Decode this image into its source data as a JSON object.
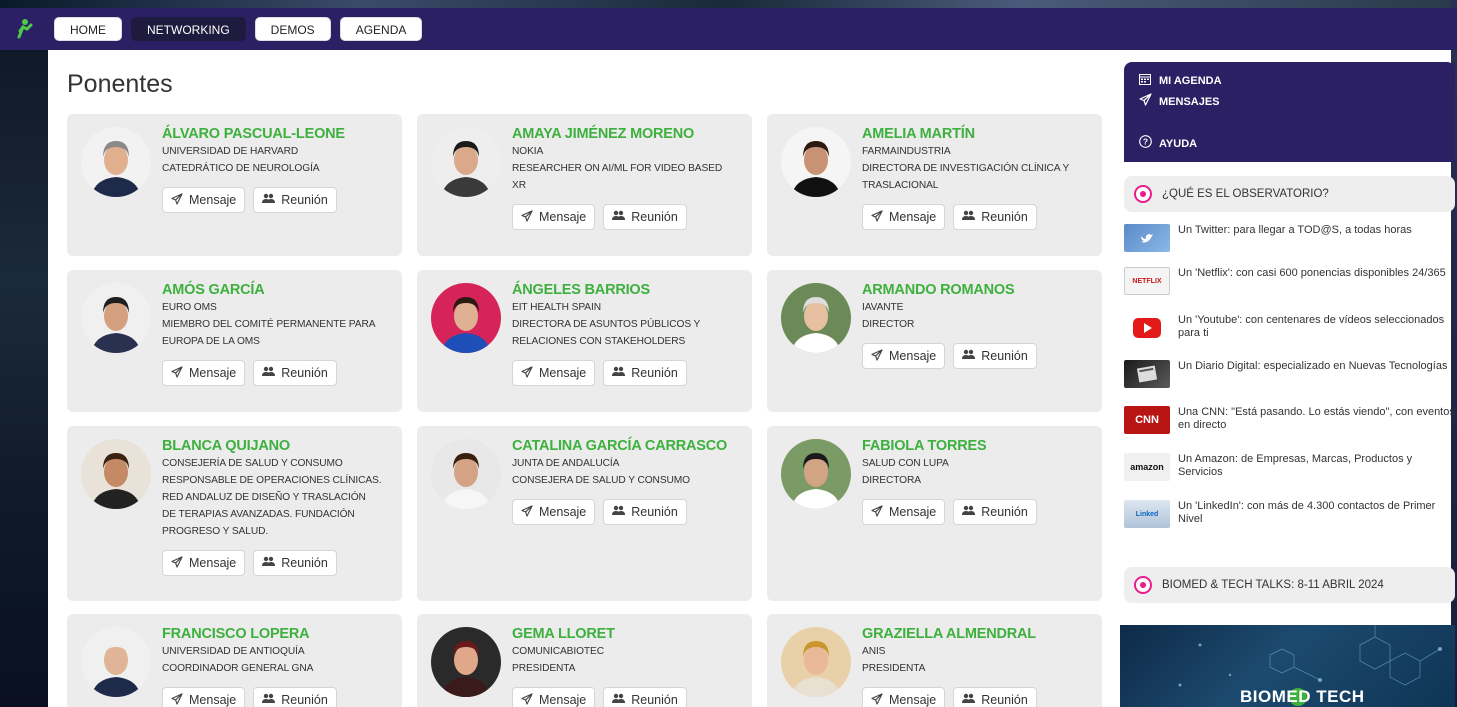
{
  "nav": {
    "items": [
      {
        "label": "HOME",
        "active": false
      },
      {
        "label": "NETWORKING",
        "active": true
      },
      {
        "label": "DEMOS",
        "active": false
      },
      {
        "label": "AGENDA",
        "active": false
      }
    ]
  },
  "page": {
    "title": "Ponentes"
  },
  "actions": {
    "message_label": "Mensaje",
    "meeting_label": "Reunión"
  },
  "speakers": [
    {
      "name": "ÁLVARO PASCUAL-LEONE",
      "lines": [
        "UNIVERSIDAD DE HARVARD",
        "CATEDRÁTICO DE NEUROLOGÍA"
      ]
    },
    {
      "name": "AMAYA JIMÉNEZ MORENO",
      "lines": [
        "NOKIA",
        "RESEARCHER ON AI/ML FOR VIDEO BASED",
        "XR"
      ]
    },
    {
      "name": "AMELIA MARTÍN",
      "lines": [
        "FARMAINDUSTRIA",
        "DIRECTORA DE INVESTIGACIÓN CLÍNICA Y",
        "TRASLACIONAL"
      ]
    },
    {
      "name": "AMÓS GARCÍA",
      "lines": [
        "EURO OMS",
        "MIEMBRO DEL COMITÉ PERMANENTE PARA",
        "EUROPA DE LA OMS"
      ]
    },
    {
      "name": "ÁNGELES BARRIOS",
      "lines": [
        "EIT HEALTH SPAIN",
        "DIRECTORA DE ASUNTOS PÚBLICOS Y",
        "RELACIONES CON STAKEHOLDERS"
      ]
    },
    {
      "name": "ARMANDO ROMANOS",
      "lines": [
        "IAVANTE",
        "DIRECTOR"
      ]
    },
    {
      "name": "BLANCA QUIJANO",
      "lines": [
        "CONSEJERÍA DE SALUD Y CONSUMO",
        "RESPONSABLE DE OPERACIONES CLÍNICAS.",
        "RED ANDALUZ DE DISEÑO Y TRASLACIÓN",
        "DE TERAPIAS AVANZADAS. FUNDACIÓN",
        "PROGRESO Y SALUD."
      ]
    },
    {
      "name": "CATALINA GARCÍA CARRASCO",
      "lines": [
        "JUNTA DE ANDALUCÍA",
        "CONSEJERA DE SALUD Y CONSUMO"
      ]
    },
    {
      "name": "FABIOLA TORRES",
      "lines": [
        "SALUD CON LUPA",
        "DIRECTORA"
      ]
    },
    {
      "name": "FRANCISCO LOPERA",
      "lines": [
        "UNIVERSIDAD DE ANTIOQUÍA",
        "COORDINADOR GENERAL GNA"
      ]
    },
    {
      "name": "GEMA LLORET",
      "lines": [
        "COMUNICABIOTEC",
        "PRESIDENTA"
      ]
    },
    {
      "name": "GRAZIELLA ALMENDRAL",
      "lines": [
        "ANIS",
        "PRESIDENTA"
      ]
    }
  ],
  "sidebar": {
    "menu": [
      {
        "label": "MI AGENDA",
        "icon": "calendar-icon"
      },
      {
        "label": "MENSAJES",
        "icon": "send-icon"
      },
      {
        "label": "AYUDA",
        "icon": "help-icon"
      }
    ],
    "observatorio_title": "¿QUÉ ES EL OBSERVATORIO?",
    "observatorio_items": [
      {
        "text": "Un Twitter: para llegar a TOD@S, a todas horas",
        "thumb": "twitter"
      },
      {
        "text": "Un 'Netflix': con casi 600 ponencias disponibles 24/365",
        "thumb": "netflix"
      },
      {
        "text": "Un 'Youtube': con centenares de vídeos seleccionados para ti",
        "thumb": "youtube"
      },
      {
        "text": "Un Diario Digital: especializado en Nuevas Tecnologías",
        "thumb": "diario"
      },
      {
        "text": "Una CNN: \"Está pasando. Lo estás viendo\", con eventos en directo",
        "thumb": "cnn"
      },
      {
        "text": "Un Amazon: de Empresas, Marcas, Productos y Servicios",
        "thumb": "amazon"
      },
      {
        "text": "Un 'LinkedIn': con más de 4.300 contactos de Primer Nivel",
        "thumb": "linkedin"
      }
    ],
    "event_title": "BIOMED & TECH TALKS: 8-11 ABRIL 2024",
    "banner_text": "BIOMED TECH",
    "thumb_labels": {
      "netflix": "NETFLIX",
      "cnn": "CNN",
      "amazon": "amazon",
      "linkedin": "Linked"
    }
  },
  "colors": {
    "nav_bg": "#2b2063",
    "accent_green": "#3db03d",
    "accent_pink": "#e91e8c"
  }
}
